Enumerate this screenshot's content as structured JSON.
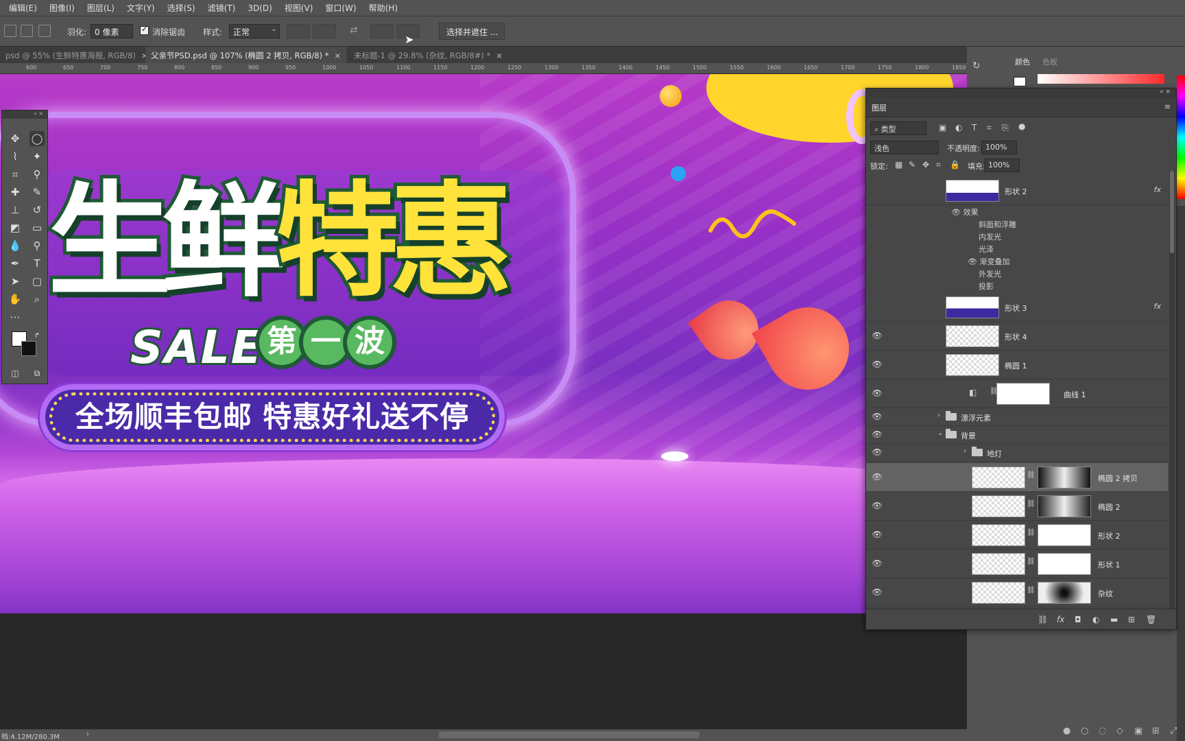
{
  "menu": [
    "编辑(E)",
    "图像(I)",
    "图层(L)",
    "文字(Y)",
    "选择(S)",
    "滤镜(T)",
    "3D(D)",
    "视图(V)",
    "窗口(W)",
    "帮助(H)"
  ],
  "options": {
    "feather_label": "羽化:",
    "feather_value": "0 像素",
    "antialias_label": "消除锯齿",
    "style_label": "样式:",
    "style_value": "正常",
    "select_mask_label": "选择并遮住 ..."
  },
  "tabs": [
    {
      "label": "psd @ 55% (生鲜特惠海报, RGB/8)",
      "close": "×"
    },
    {
      "label": "父亲节PSD.psd @ 107% (椭圆 2 拷贝, RGB/8) *",
      "close": "×"
    },
    {
      "label": "未标题-1 @ 29.8% (杂纹, RGB/8#) *",
      "close": "×"
    }
  ],
  "ruler": [
    "600",
    "650",
    "700",
    "750",
    "800",
    "850",
    "900",
    "950",
    "1000",
    "1050",
    "1100",
    "1150",
    "1200",
    "1250",
    "1300",
    "1350",
    "1400",
    "1450",
    "1500",
    "1550",
    "1600",
    "1650",
    "1700",
    "1750",
    "1800",
    "1850"
  ],
  "canvas": {
    "title_white": "生鲜",
    "title_yellow": "特惠",
    "sale": "SALE",
    "wave": [
      "第",
      "一",
      "波"
    ],
    "banner": "全场顺丰包邮 特惠好礼送不停"
  },
  "colorpanel": {
    "tab1": "颜色",
    "tab2": "色板"
  },
  "layers_panel": {
    "title": "图层",
    "filter_kind": "类型",
    "blend_mode": "浅色",
    "opacity_label": "不透明度:",
    "opacity_value": "100%",
    "lock_label": "锁定:",
    "fill_label": "填充:",
    "fill_value": "100%",
    "effects_label": "效果",
    "effects": [
      "斜面和浮雕",
      "内发光",
      "光泽",
      "渐变叠加",
      "外发光",
      "投影"
    ],
    "layers": [
      {
        "name": "形状 2",
        "fx": "fx"
      },
      {
        "name": "形状 3",
        "fx": "fx"
      },
      {
        "name": "形状 4"
      },
      {
        "name": "椭圆 1"
      },
      {
        "name": "曲线 1"
      }
    ],
    "groups": [
      {
        "name": "漂浮元素"
      },
      {
        "name": "背景"
      },
      {
        "name": "地灯"
      }
    ],
    "masked_layers": [
      {
        "name": "椭圆 2 拷贝"
      },
      {
        "name": "椭圆 2"
      },
      {
        "name": "形状 2"
      },
      {
        "name": "形状 1"
      },
      {
        "name": "杂纹"
      }
    ]
  },
  "status": {
    "doc": "档:4.12M/280.3M"
  },
  "colors": {
    "ui_bg": "#535353",
    "canvas_purple": "#9630c6",
    "title_yellow": "#ffe33b",
    "banner_blue": "#4a2aa8"
  }
}
